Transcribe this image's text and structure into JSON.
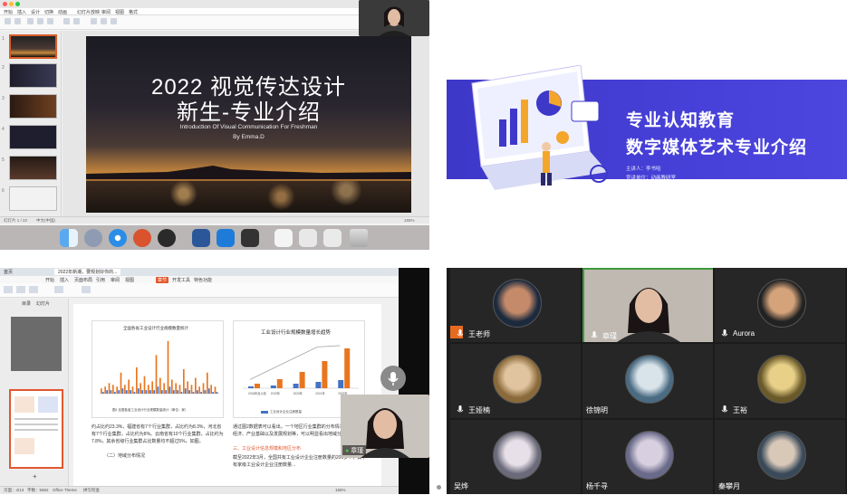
{
  "presentation_app": {
    "tabs": [
      "开始",
      "插入",
      "设计",
      "切换",
      "动画",
      "幻灯片放映",
      "审阅",
      "视图",
      "格式"
    ],
    "slide": {
      "title_line1": "2022 视觉传达设计",
      "title_line2": "新生-专业介绍",
      "subtitle": "Introduction Of Visual Communication For Freshman",
      "byline": "By Emma.D"
    },
    "status_left": "幻灯片 1 / 22",
    "status_lang": "中文(中国)",
    "status_zoom": "155%"
  },
  "banner": {
    "heading1": "专业认知教育",
    "heading2": "数字媒体艺术专业介绍",
    "speaker": "主讲人：李书哈",
    "unit": "宣讲单位：动画教研室"
  },
  "document_app": {
    "tabs": [
      "首页",
      "2022年新潮，要规划好你的..."
    ],
    "menu": [
      "开始",
      "插入",
      "页面布局",
      "引用",
      "审阅",
      "视图",
      "章节",
      "开发工具",
      "特色功能"
    ],
    "menu_active": "章节",
    "left_tabs": [
      "目录",
      "幻灯片"
    ],
    "chart1_title": "全国各省工业设计行业规模数量统计",
    "chart1_caption": "图1 全国各省工业设计行业规模数量统计（单位：家）",
    "chart2_title": "工业设计行业规模数量增长趋势",
    "chart2_legend": "工业设计企业注册数量",
    "chart2_categories": [
      "2018年及以前",
      "2019年",
      "2020年",
      "2021年",
      "2022年"
    ],
    "para_left": "约占比约23.3%，福建省有7个行业集群，占比约为8.3%，河北省有7个行业集群，占比约为8%。云南省有10个行业集群，占比约为7.8%，其余省级行业集群占比数量均不超过5%，如图。",
    "para_left_heading": "（二）地域分布情况",
    "para_right": "通过图2数据表可以看出，一个地区行业集群的分布情况与该地区的经济、产业基础以及发展规划等，可以明显看出地域分布情况。",
    "para_right_heading": "三、工业设计信息规模和地区分布",
    "para_right2": "截至2022年3月，全国共有工业设计企业注册数量的200多个，其中有家级工业设计企业注册数量...",
    "status": [
      "页面：4/13",
      "字数：5962",
      "Office Theme",
      "拼写检查",
      "155%"
    ],
    "speaker_name": "章瑾"
  },
  "video_call": {
    "participants": [
      {
        "name": "王老师",
        "host": true
      },
      {
        "name": "章瑾",
        "active": true
      },
      {
        "name": "Aurora"
      },
      {
        "name": "王娅楠"
      },
      {
        "name": "徐锦明"
      },
      {
        "name": "王裕"
      },
      {
        "name": "吴烨"
      },
      {
        "name": "杨千寻"
      },
      {
        "name": "秦攀月"
      }
    ]
  },
  "chart_data": [
    {
      "type": "bar",
      "title": "全国各省工业设计行业规模数量统计",
      "series": [
        {
          "name": "",
          "values": [
            3,
            4,
            6,
            5,
            4,
            12,
            5,
            8,
            4,
            15,
            6,
            10,
            5,
            7,
            22,
            9,
            6,
            30,
            8,
            6,
            5,
            14,
            7,
            5,
            9,
            4,
            6,
            12,
            5,
            4
          ]
        },
        {
          "name": "",
          "values": [
            1,
            2,
            2,
            1,
            2,
            3,
            2,
            2,
            1,
            3,
            2,
            2,
            2,
            2,
            4,
            2,
            2,
            4,
            2,
            2,
            1,
            3,
            2,
            1,
            2,
            1,
            2,
            3,
            1,
            1
          ]
        }
      ]
    },
    {
      "type": "bar",
      "title": "工业设计行业规模数量增长趋势",
      "categories": [
        "2018年及以前",
        "2019年",
        "2020年",
        "2021年",
        "2022年"
      ],
      "series": [
        {
          "name": "工业设计企业注册数量",
          "values": [
            2,
            3,
            5,
            7,
            9
          ]
        },
        {
          "name": "",
          "values": [
            5,
            10,
            18,
            30,
            44
          ]
        }
      ],
      "line": [
        20,
        45,
        70,
        95,
        98
      ]
    }
  ],
  "colors": {
    "banner_blue": "#4740d8",
    "accent_orange": "#e2572e",
    "active_green": "#3d9b3a",
    "call_bg": "#1b1b1b"
  }
}
